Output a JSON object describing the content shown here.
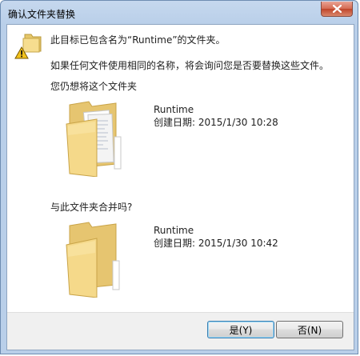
{
  "window": {
    "title": "确认文件夹替换",
    "close_icon": "close-icon"
  },
  "message": {
    "icon": "warning-folder-icon",
    "line1": "此目标已包含名为“Runtime”的文件夹。",
    "line2": "如果任何文件使用相同的名称，将会询问您是否要替换这些文件。",
    "line3": "您仍想将这个文件夹",
    "line4": "与此文件夹合并吗?"
  },
  "source_folder": {
    "icon": "folder-with-files-icon",
    "name": "Runtime",
    "date_label": "创建日期:",
    "date_value": "2015/1/30 10:28"
  },
  "target_folder": {
    "icon": "folder-icon",
    "name": "Runtime",
    "date_label": "创建日期:",
    "date_value": "2015/1/30 10:42"
  },
  "buttons": {
    "yes_label": "是(Y)",
    "no_label": "否(N)"
  },
  "colors": {
    "title_bar": "#b9cfe9",
    "close_button": "#c7503a",
    "folder": "#f3d27a"
  }
}
